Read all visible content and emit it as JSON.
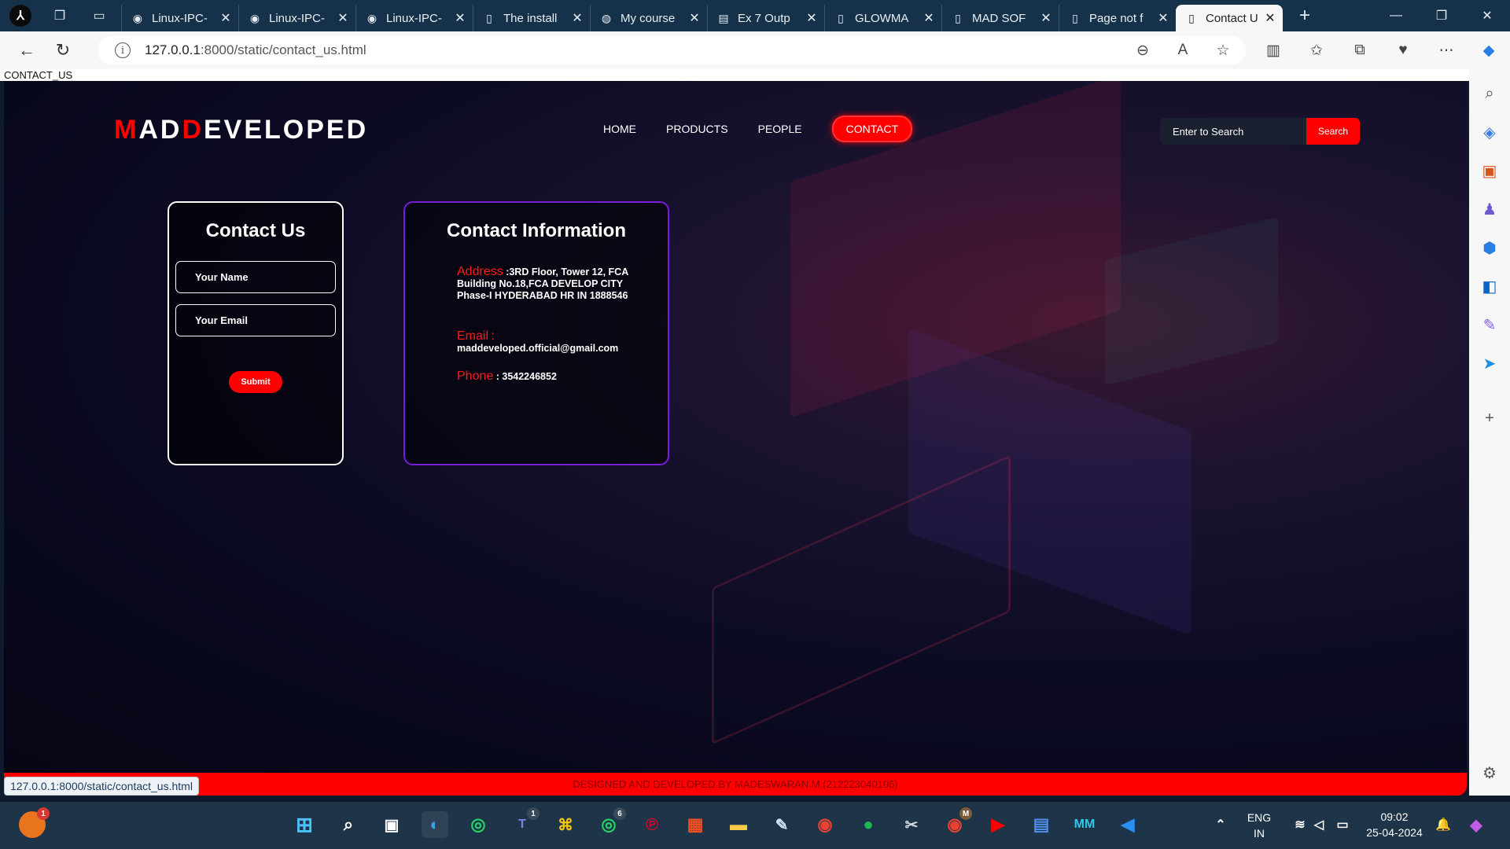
{
  "browser": {
    "tabs": [
      {
        "title": "Linux-IPC-",
        "icon": "github-icon"
      },
      {
        "title": "Linux-IPC-",
        "icon": "github-icon"
      },
      {
        "title": "Linux-IPC-",
        "icon": "github-icon"
      },
      {
        "title": "The install",
        "icon": "page-icon"
      },
      {
        "title": "My course",
        "icon": "moodle-icon"
      },
      {
        "title": "Ex 7 Outp",
        "icon": "pdf-icon"
      },
      {
        "title": "GLOWMA",
        "icon": "page-icon"
      },
      {
        "title": "MAD SOF",
        "icon": "page-icon"
      },
      {
        "title": "Page not f",
        "icon": "page-icon"
      },
      {
        "title": "Contact U",
        "icon": "page-icon",
        "active": true
      }
    ],
    "url_host": "127.0.0.1",
    "url_path": ":8000/static/contact_us.html",
    "status_url": "127.0.0.1:8000/static/contact_us.html"
  },
  "page": {
    "doc_title": "CONTACT_US",
    "brand": {
      "m": "M",
      "a": "AD",
      "d": "D",
      "rest": "EVELOPED"
    },
    "nav": [
      "HOME",
      "PRODUCTS",
      "PEOPLE",
      "CONTACT"
    ],
    "search": {
      "placeholder": "Enter to Search",
      "button": "Search"
    },
    "form": {
      "title": "Contact Us",
      "name_placeholder": "Your Name",
      "email_placeholder": "Your Email",
      "submit": "Submit"
    },
    "info": {
      "title": "Contact Information",
      "address_label": "Address",
      "address_text": ":3RD Floor, Tower 12, FCA Building No.18,FCA DEVELOP CITY Phase-I HYDERABAD HR IN 1888546",
      "email_label": "Email",
      "email_text": "maddeveloped.official@gmail.com",
      "phone_label": "Phone",
      "phone_text": "3542246852"
    },
    "footer": "DESIGNED AND DEVELOPED BY MADESWARAN M.(212223040106)"
  },
  "taskbar": {
    "apps": [
      {
        "name": "start",
        "icon": "windows-icon"
      },
      {
        "name": "search",
        "icon": "search-icon"
      },
      {
        "name": "task-view",
        "icon": "taskview-icon"
      },
      {
        "name": "edge",
        "icon": "edge-icon"
      },
      {
        "name": "whatsapp",
        "icon": "whatsapp-icon"
      },
      {
        "name": "teams",
        "icon": "teams-icon",
        "badge": "1"
      },
      {
        "name": "python",
        "icon": "python-icon"
      },
      {
        "name": "whatsapp-business",
        "icon": "whatsapp-icon",
        "badge": "6"
      },
      {
        "name": "pinterest",
        "icon": "pinterest-icon"
      },
      {
        "name": "office",
        "icon": "office-icon"
      },
      {
        "name": "explorer",
        "icon": "folder-icon"
      },
      {
        "name": "notepad",
        "icon": "notepad-icon"
      },
      {
        "name": "chrome",
        "icon": "chrome-icon"
      },
      {
        "name": "spotify",
        "icon": "spotify-icon"
      },
      {
        "name": "snipping",
        "icon": "snip-icon"
      },
      {
        "name": "chrome-profile",
        "icon": "chrome-icon",
        "badge": "M"
      },
      {
        "name": "youtube",
        "icon": "youtube-icon"
      },
      {
        "name": "store",
        "icon": "store-icon"
      },
      {
        "name": "mm",
        "icon": "mm-icon"
      },
      {
        "name": "vscode",
        "icon": "vscode-icon"
      }
    ],
    "widget_badge": "1",
    "lang": "ENG",
    "region": "IN",
    "time": "09:02",
    "date": "25-04-2024"
  },
  "colors": {
    "accent": "#ff0000",
    "info_border": "#7a1bdc",
    "tabbar": "#16324a",
    "taskbar": "#1e3448"
  }
}
